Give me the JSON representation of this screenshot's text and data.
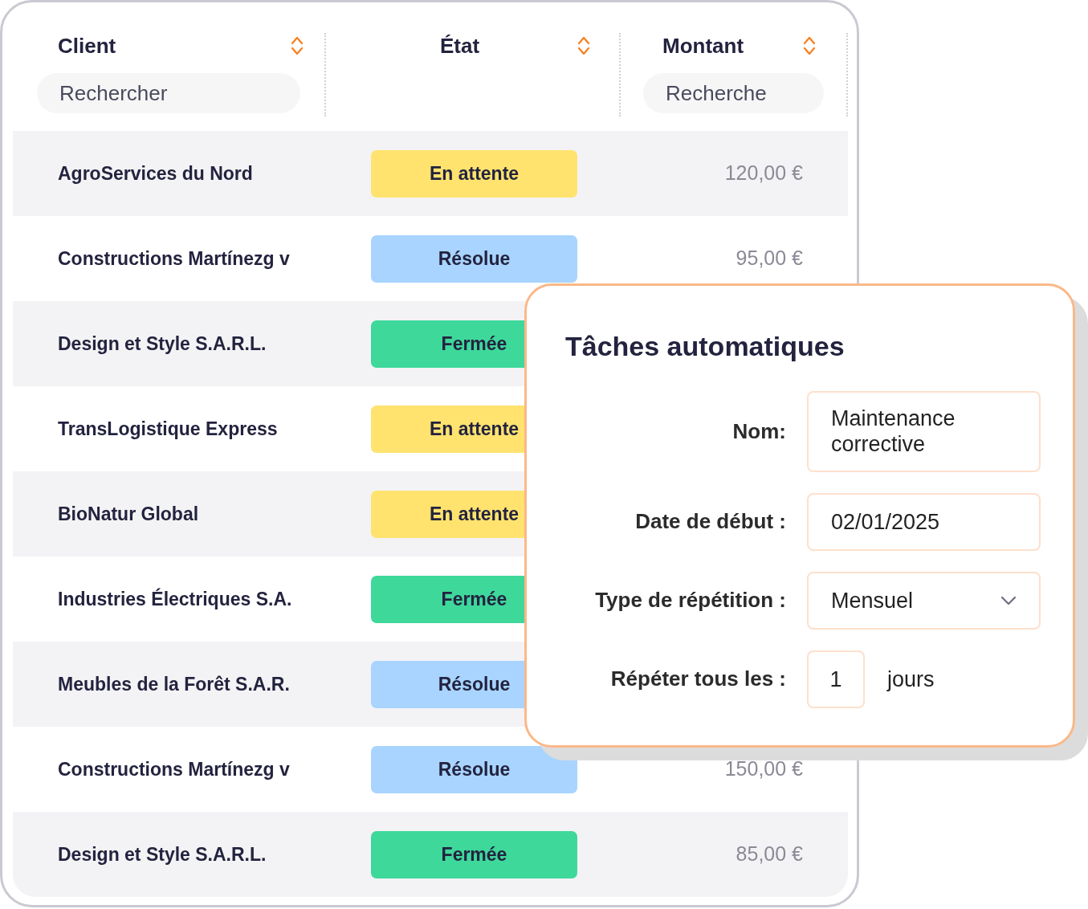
{
  "table": {
    "columns": [
      {
        "label": "Client",
        "search_placeholder": "Rechercher"
      },
      {
        "label": "État"
      },
      {
        "label": "Montant",
        "search_placeholder": "Recherche"
      }
    ],
    "rows": [
      {
        "client": "AgroServices du Nord",
        "status": {
          "label": "En attente",
          "color": "#ffe36e"
        },
        "amount": "120,00 €"
      },
      {
        "client": "Constructions Martínezg v",
        "status": {
          "label": "Résolue",
          "color": "#a8d4ff"
        },
        "amount": "95,00 €"
      },
      {
        "client": "Design et Style S.A.R.L.",
        "status": {
          "label": "Fermée",
          "color": "#3ed89b"
        }
      },
      {
        "client": "TransLogistique Express",
        "status": {
          "label": "En attente",
          "color": "#ffe36e"
        }
      },
      {
        "client": "BioNatur Global",
        "status": {
          "label": "En attente",
          "color": "#ffe36e"
        }
      },
      {
        "client": "Industries Électriques S.A.",
        "status": {
          "label": "Fermée",
          "color": "#3ed89b"
        }
      },
      {
        "client": "Meubles de la Forêt S.A.R.",
        "status": {
          "label": "Résolue",
          "color": "#a8d4ff"
        }
      },
      {
        "client": "Constructions Martínezg v",
        "status": {
          "label": "Résolue",
          "color": "#a8d4ff"
        },
        "amount": "150,00 €"
      },
      {
        "client": "Design et Style S.A.R.L.",
        "status": {
          "label": "Fermée",
          "color": "#3ed89b"
        },
        "amount": "85,00 €"
      }
    ]
  },
  "dialog": {
    "title": "Tâches automatiques",
    "fields": [
      {
        "kind": "text",
        "label": "Nom:",
        "value": "Maintenance corrective"
      },
      {
        "kind": "text",
        "label": "Date de début :",
        "value": "02/01/2025"
      },
      {
        "kind": "select",
        "label": "Type de répétition :",
        "value": "Mensuel"
      },
      {
        "kind": "number",
        "label": "Répéter tous les :",
        "value": "1",
        "unit": "jours"
      }
    ]
  }
}
